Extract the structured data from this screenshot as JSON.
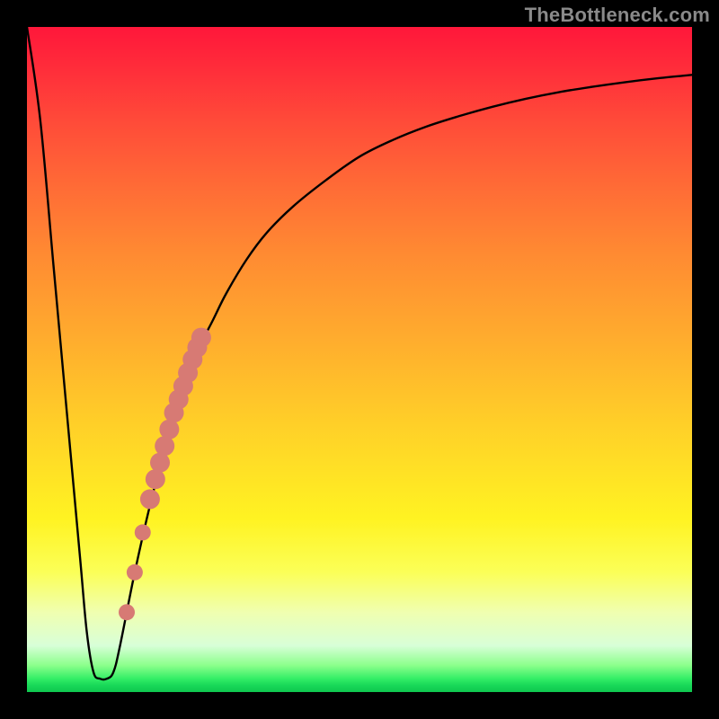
{
  "watermark": "TheBottleneck.com",
  "colors": {
    "curve_stroke": "#000000",
    "dot_fill": "#d77a74",
    "background_frame": "#000000"
  },
  "chart_data": {
    "type": "line",
    "title": "",
    "xlabel": "",
    "ylabel": "",
    "xlim": [
      0,
      100
    ],
    "ylim": [
      0,
      100
    ],
    "series": [
      {
        "name": "curve",
        "x": [
          0,
          2,
          4,
          6,
          8,
          9,
          10,
          11,
          12,
          13,
          14,
          16,
          18,
          20,
          22,
          24,
          26,
          28,
          30,
          33,
          36,
          40,
          45,
          50,
          55,
          60,
          65,
          70,
          75,
          80,
          85,
          90,
          95,
          100
        ],
        "y": [
          100,
          86,
          64,
          42,
          20,
          9,
          3,
          2,
          2,
          3,
          7,
          17,
          26,
          34,
          41,
          47,
          52,
          56,
          60,
          65,
          69,
          73,
          77,
          80.5,
          83,
          85,
          86.6,
          88,
          89.2,
          90.2,
          91,
          91.7,
          92.3,
          92.8
        ]
      }
    ],
    "dots": [
      {
        "x": 15.0,
        "y": 12
      },
      {
        "x": 16.2,
        "y": 18
      },
      {
        "x": 17.4,
        "y": 24
      },
      {
        "x": 18.5,
        "y": 29
      },
      {
        "x": 19.3,
        "y": 32
      },
      {
        "x": 20.0,
        "y": 34.5
      },
      {
        "x": 20.7,
        "y": 37
      },
      {
        "x": 21.4,
        "y": 39.5
      },
      {
        "x": 22.1,
        "y": 42
      },
      {
        "x": 22.8,
        "y": 44
      },
      {
        "x": 23.5,
        "y": 46
      },
      {
        "x": 24.2,
        "y": 48
      },
      {
        "x": 24.9,
        "y": 50
      },
      {
        "x": 25.6,
        "y": 51.8
      },
      {
        "x": 26.2,
        "y": 53.3
      }
    ]
  }
}
